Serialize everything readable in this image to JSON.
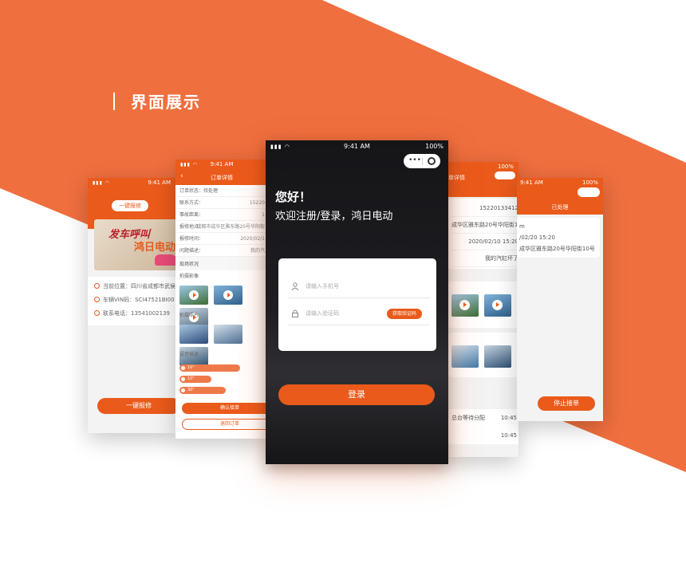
{
  "heading": "界面展示",
  "colors": {
    "brand": "#ea5a1b",
    "band": "#ef6f3f",
    "dark": "#151518"
  },
  "phone1": {
    "status_time": "9:41 AM",
    "pill": "一键报修",
    "banner_line1": "发车呼叫",
    "banner_line2": "鸿日电动",
    "info": [
      {
        "icon": "location-icon",
        "text": "当前位置：四川省成都市武侯"
      },
      {
        "icon": "car-icon",
        "text": "车辆VIN码：SCI47521BI00"
      },
      {
        "icon": "phone-icon",
        "text": "联系电话：13541002139"
      }
    ],
    "button": "一键报修"
  },
  "phone2": {
    "status_time": "9:41 AM",
    "title": "订单详情",
    "status_row": "订单状态：待处理",
    "fields": [
      {
        "label": "联系方式：",
        "value": "15220"
      },
      {
        "label": "事故距离：",
        "value": "1"
      },
      {
        "label": "报修地点：",
        "value": "成都市成华区雅东路20号华阳街"
      },
      {
        "label": "报修时间：",
        "value": "2020/02/1"
      },
      {
        "label": "问题描述：",
        "value": "我的汽"
      }
    ],
    "site_title": "现场状况",
    "video_title": "拍摄影像",
    "photo_title": "拍摄照片",
    "voice_title": "语音描述",
    "voices": [
      "10\"",
      "10\"",
      "30\""
    ],
    "confirm": "确认接单",
    "reject": "退回订单"
  },
  "phone3": {
    "status_time": "9:41 AM",
    "battery": "100%",
    "hello": "您好！",
    "welcome": "欢迎注册/登录，鸿日电动",
    "phone_placeholder": "请输入手机号",
    "code_placeholder": "请输入验证码",
    "code_button": "获取验证码",
    "login": "登录"
  },
  "phone4": {
    "title": "单详情",
    "battery": "100%",
    "rows": [
      "15220133412",
      "成华区雅东路20号华阳街10号",
      "2020/02/10 15:20",
      "我的汽缸坏了"
    ],
    "logs": [
      {
        "text": "总台等待分配",
        "time": "10:45"
      },
      {
        "text": "",
        "time": "10:45"
      }
    ]
  },
  "phone5": {
    "status_time": "9:41 AM",
    "battery": "100%",
    "status": "已处理",
    "rows": [
      "m",
      "/02/20 15:20",
      "成华区雅东路20号华阳街10号"
    ],
    "button": "停止接单"
  }
}
